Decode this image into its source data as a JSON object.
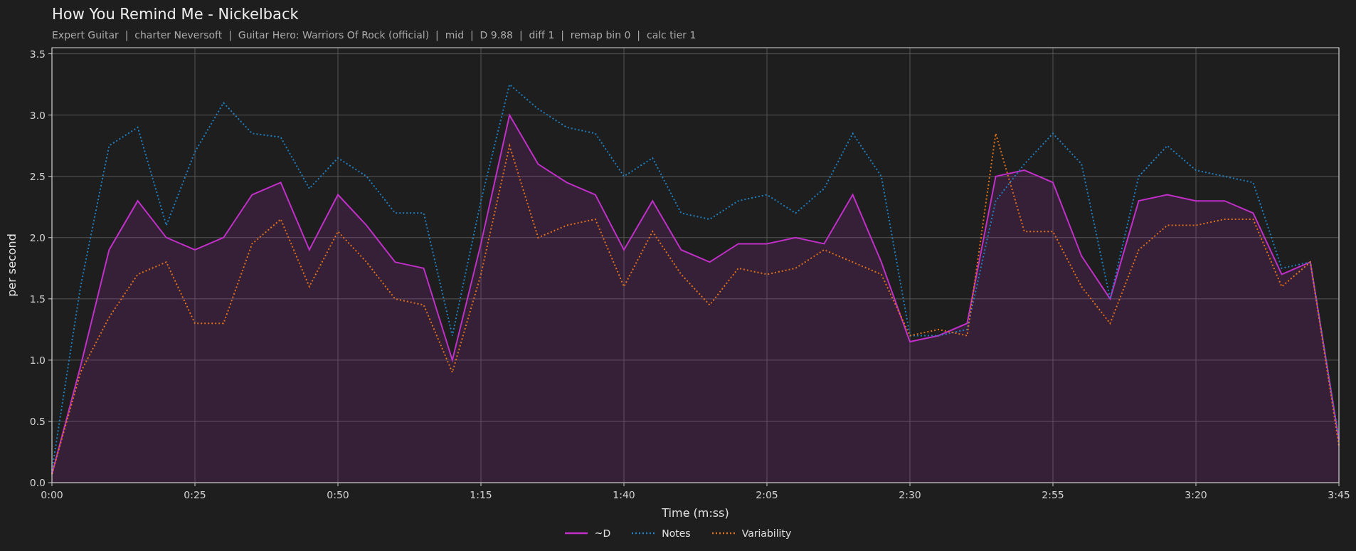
{
  "subtitle": "Expert Guitar  |  charter Neversoft  |  Guitar Hero: Warriors Of Rock (official)  |  mid  |  D 9.88  |  diff 1  |  remap bin 0  |  calc tier 1",
  "chart": {
    "chart_data": {
      "type": "line",
      "title": "How You Remind Me - Nickelback",
      "xlabel": "Time (m:ss)",
      "ylabel": "per second",
      "x": [
        0,
        5,
        10,
        15,
        20,
        25,
        30,
        35,
        40,
        45,
        50,
        55,
        60,
        65,
        70,
        75,
        80,
        85,
        90,
        95,
        100,
        105,
        110,
        115,
        120,
        125,
        130,
        135,
        140,
        145,
        150,
        155,
        160,
        165,
        170,
        175,
        180,
        185,
        190,
        195,
        200,
        205,
        210,
        215,
        220,
        225
      ],
      "series": [
        {
          "name": "~D",
          "color": "#c030c8",
          "type": "area",
          "line_style": "solid",
          "values": [
            0.07,
            0.95,
            1.9,
            2.3,
            2.0,
            1.9,
            2.0,
            2.35,
            2.45,
            1.9,
            2.35,
            2.1,
            1.8,
            1.75,
            1.0,
            1.95,
            3.0,
            2.6,
            2.45,
            2.35,
            1.9,
            2.3,
            1.9,
            1.8,
            1.95,
            1.95,
            2.0,
            1.95,
            2.35,
            1.8,
            1.15,
            1.2,
            1.3,
            2.5,
            2.55,
            2.45,
            1.85,
            1.5,
            2.3,
            2.35,
            2.3,
            2.3,
            2.2,
            1.7,
            1.8,
            0.35
          ]
        },
        {
          "name": "Notes",
          "color": "#1f7fc0",
          "type": "line",
          "line_style": "dotted",
          "values": [
            0.1,
            1.6,
            2.75,
            2.9,
            2.1,
            2.7,
            3.1,
            2.85,
            2.82,
            2.4,
            2.65,
            2.5,
            2.2,
            2.2,
            1.2,
            2.3,
            3.25,
            3.05,
            2.9,
            2.85,
            2.5,
            2.65,
            2.2,
            2.15,
            2.3,
            2.35,
            2.2,
            2.4,
            2.85,
            2.5,
            1.2,
            1.2,
            1.25,
            2.3,
            2.6,
            2.85,
            2.6,
            1.5,
            2.5,
            2.75,
            2.55,
            2.5,
            2.45,
            1.75,
            1.8,
            0.35
          ]
        },
        {
          "name": "Variability",
          "color": "#e0701a",
          "type": "line",
          "line_style": "dotted",
          "values": [
            0.07,
            0.9,
            1.35,
            1.7,
            1.8,
            1.3,
            1.3,
            1.95,
            2.15,
            1.6,
            2.05,
            1.8,
            1.5,
            1.45,
            0.9,
            1.7,
            2.75,
            2.0,
            2.1,
            2.15,
            1.6,
            2.05,
            1.7,
            1.45,
            1.75,
            1.7,
            1.75,
            1.9,
            1.8,
            1.7,
            1.2,
            1.25,
            1.2,
            2.85,
            2.05,
            2.05,
            1.6,
            1.3,
            1.9,
            2.1,
            2.1,
            2.15,
            2.15,
            1.6,
            1.8,
            0.3
          ]
        }
      ],
      "grid": true,
      "xlim": [
        0,
        225
      ],
      "ylim": [
        0,
        3.55
      ],
      "xticks": [
        {
          "value": 0,
          "label": "0:00"
        },
        {
          "value": 25,
          "label": "0:25"
        },
        {
          "value": 50,
          "label": "0:50"
        },
        {
          "value": 75,
          "label": "1:15"
        },
        {
          "value": 100,
          "label": "1:40"
        },
        {
          "value": 125,
          "label": "2:05"
        },
        {
          "value": 150,
          "label": "2:30"
        },
        {
          "value": 175,
          "label": "2:55"
        },
        {
          "value": 200,
          "label": "3:20"
        },
        {
          "value": 225,
          "label": "3:45"
        }
      ],
      "yticks": [
        {
          "value": 0,
          "label": "0.0"
        },
        {
          "value": 0.5,
          "label": "0.5"
        },
        {
          "value": 1,
          "label": "1.0"
        },
        {
          "value": 1.5,
          "label": "1.5"
        },
        {
          "value": 2,
          "label": "2.0"
        },
        {
          "value": 2.5,
          "label": "2.5"
        },
        {
          "value": 3,
          "label": "3.0"
        },
        {
          "value": 3.5,
          "label": "3.5"
        }
      ]
    }
  }
}
